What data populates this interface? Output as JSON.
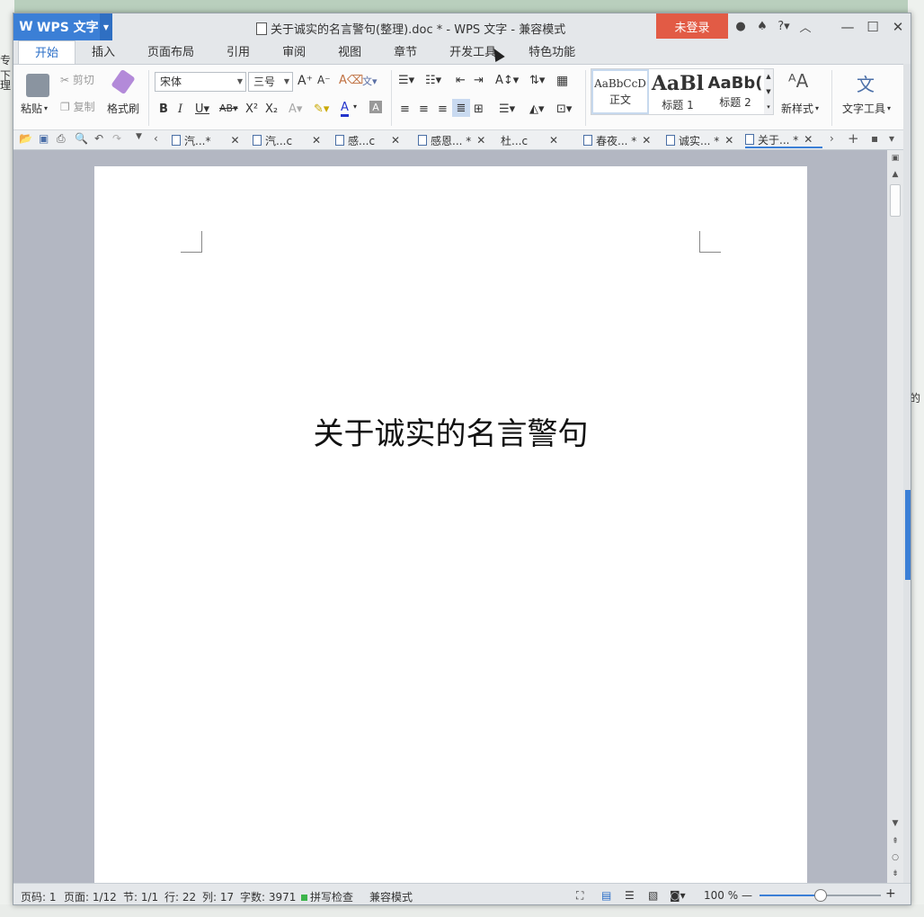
{
  "window": {
    "app_name": "WPS 文字",
    "title": "关于诚实的名言警句(整理).doc * - WPS 文字 - 兼容模式",
    "login_label": "未登录"
  },
  "ribbon_tabs": [
    "开始",
    "插入",
    "页面布局",
    "引用",
    "审阅",
    "视图",
    "章节",
    "开发工具",
    "特色功能"
  ],
  "ribbon": {
    "paste": "粘贴",
    "cut": "剪切",
    "copy": "复制",
    "format_painter": "格式刷",
    "font_name": "宋体",
    "font_size": "三号",
    "styles": [
      {
        "sample": "AaBbCcD",
        "name": "正文"
      },
      {
        "sample": "AaBl",
        "name": "标题 1"
      },
      {
        "sample": "AaBb(",
        "name": "标题 2"
      }
    ],
    "new_style": "新样式",
    "text_tools": "文字工具"
  },
  "doc_tabs": [
    {
      "label": "汽...*"
    },
    {
      "label": "汽...c"
    },
    {
      "label": "感...c"
    },
    {
      "label": "感恩... *"
    },
    {
      "label": "杜...c"
    },
    {
      "label": "春夜... *"
    },
    {
      "label": "诚实... *"
    },
    {
      "label": "关于... *"
    }
  ],
  "document": {
    "heading": "关于诚实的名言警句"
  },
  "status": {
    "page_code": "页码: 1",
    "pages": "页面: 1/12",
    "section": "节: 1/1",
    "line": "行: 22",
    "column": "列: 17",
    "word_count": "字数: 3971",
    "spell_check": "拼写检查",
    "mode": "兼容模式",
    "zoom": "100 %",
    "zoom_level": 0.5
  },
  "background": {
    "left_labels": [
      "专下",
      "理",
      "下"
    ],
    "right_label": "的"
  },
  "colors": {
    "accent": "#3b7fd6",
    "login": "#e25b45"
  }
}
